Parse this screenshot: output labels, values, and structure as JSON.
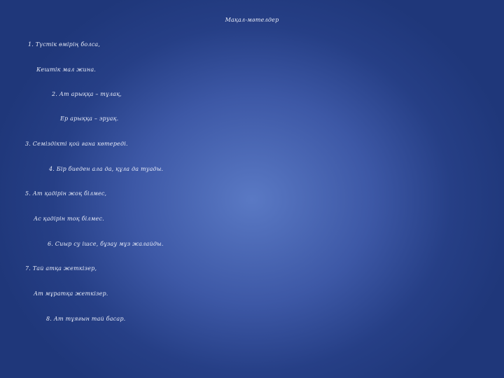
{
  "slide": {
    "title": "Мақал-мәтелдер",
    "lines": [
      "1. Түстік өмірің болса,",
      "Кештік мал жина.",
      "2. Ат арыққа – тұлақ,",
      "Ер арыққа – эруақ.",
      "3. Семіздікті қой ғана көтереді.",
      "4. Бір биеден ала да, құла да туады.",
      "5. Ат қадірін жоқ білмес,",
      "Ас қадірін тоқ білмес.",
      "6. Сиыр су ішсе, бұзау мұз жалайды.",
      "7. Тай атқа жеткізер,",
      "Ат мұратқа жеткізер.",
      "8. Ат тұяғын тай басар."
    ]
  }
}
